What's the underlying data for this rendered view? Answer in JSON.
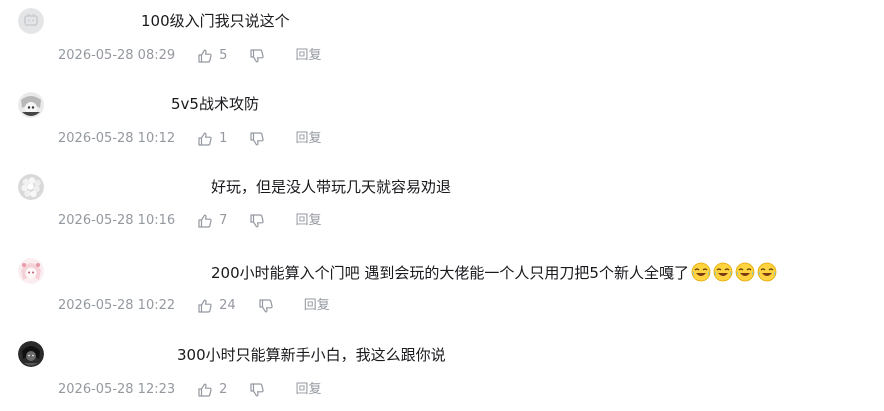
{
  "comments": [
    {
      "text": "100级入门我只说这个",
      "timestamp": "2026-05-28 08:29",
      "likes": "5",
      "reply_label": "回复"
    },
    {
      "text": "5v5战术攻防",
      "timestamp": "2026-05-28 10:12",
      "likes": "1",
      "reply_label": "回复"
    },
    {
      "text": "好玩，但是没人带玩几天就容易劝退",
      "timestamp": "2026-05-28 10:16",
      "likes": "7",
      "reply_label": "回复"
    },
    {
      "text": "200小时能算入个门吧 遇到会玩的大佬能一个人只用刀把5个新人全嘎了",
      "timestamp": "2026-05-28 10:22",
      "likes": "24",
      "reply_label": "回复",
      "emojis": [
        "laugh-cry-emoji",
        "laugh-cry-emoji",
        "laugh-cry-emoji",
        "laugh-cry-emoji"
      ]
    },
    {
      "text": "300小时只能算新手小白，我这么跟你说",
      "timestamp": "2026-05-28 12:23",
      "likes": "2",
      "reply_label": "回复"
    }
  ],
  "colors": {
    "text": "#18191c",
    "meta": "#9499a0"
  },
  "icons": {
    "like": "thumb-up-icon",
    "dislike": "thumb-down-icon"
  }
}
